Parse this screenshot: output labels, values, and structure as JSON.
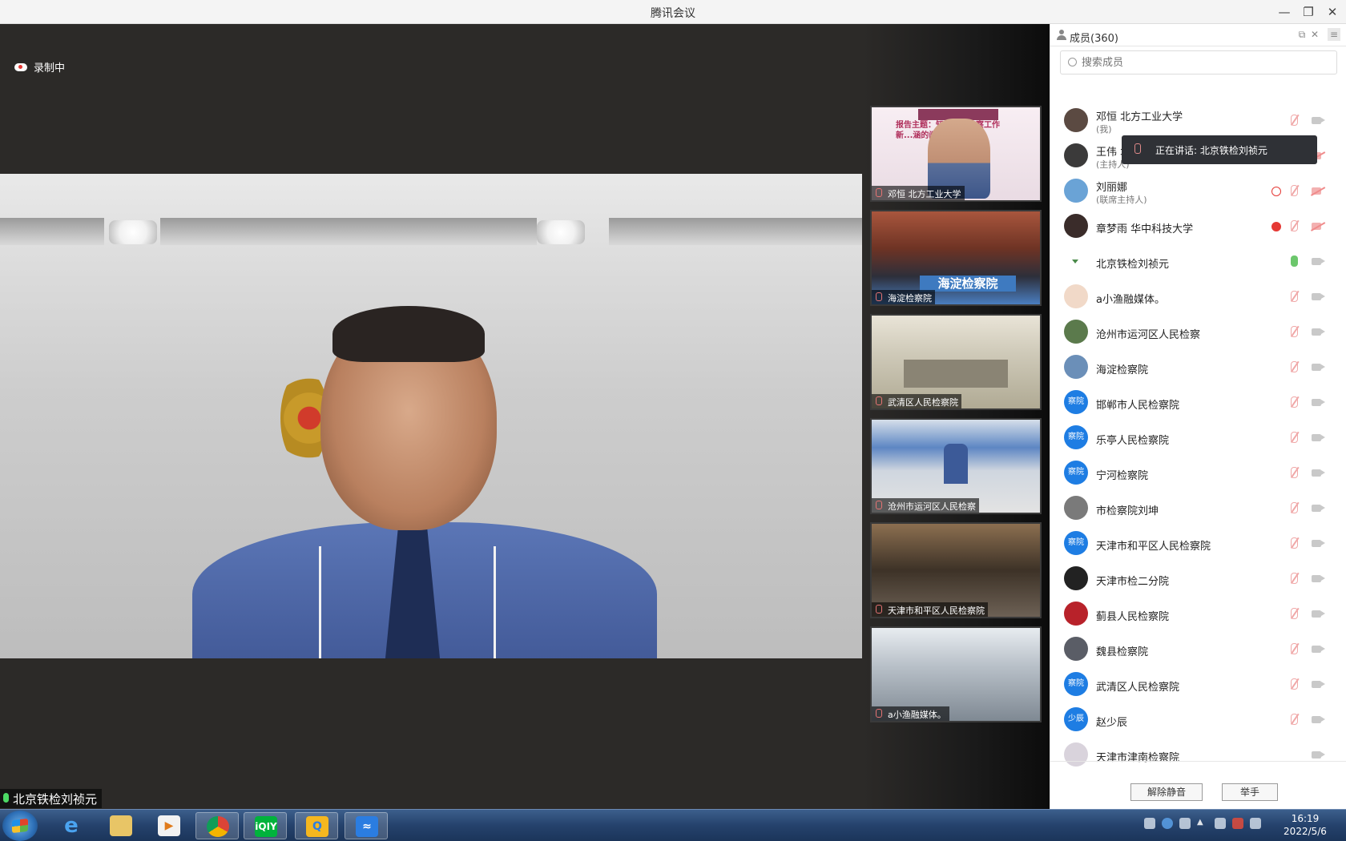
{
  "window": {
    "title": "腾讯会议"
  },
  "stage": {
    "recording_label": "录制中",
    "speaker_label": "北京铁检刘祯元"
  },
  "thumbnails": [
    {
      "label": "邓恒 北方工业大学",
      "overlay_text": "报告主题：知识产权检察工作新...涵的阐释"
    },
    {
      "label": "海淀检察院",
      "overlay_text": "海淀检察院"
    },
    {
      "label": "武清区人民检察院"
    },
    {
      "label": "沧州市运河区人民检察"
    },
    {
      "label": "天津市和平区人民检察院"
    },
    {
      "label": "a小渔融媒体。"
    }
  ],
  "members_panel": {
    "title": "成员(360)",
    "search_placeholder": "搜索成员",
    "speaking_tooltip": "正在讲话: 北京铁检刘祯元",
    "members": [
      {
        "name": "邓恒 北方工业大学",
        "sub": "(我)",
        "avatar_text": "",
        "avatar_color": "#5b4a42"
      },
      {
        "name": "王伟 北方工业大学",
        "sub": "(主持人)",
        "avatar_text": "",
        "avatar_color": "#3b3a3a"
      },
      {
        "name": "刘丽娜",
        "sub": "(联席主持人)",
        "avatar_text": "",
        "avatar_color": "#6aa3d6"
      },
      {
        "name": "章梦雨 华中科技大学",
        "sub": "",
        "avatar_text": "",
        "avatar_color": "#3a2c2a"
      },
      {
        "name": "北京铁检刘祯元",
        "sub": "",
        "avatar_text": "",
        "avatar_color": "#ffffff"
      },
      {
        "name": "a小渔融媒体。",
        "sub": "",
        "avatar_text": "",
        "avatar_color": "#f1d9c8"
      },
      {
        "name": "沧州市运河区人民检察",
        "sub": "",
        "avatar_text": "",
        "avatar_color": "#5b7a4c"
      },
      {
        "name": "海淀检察院",
        "sub": "",
        "avatar_text": "",
        "avatar_color": "#6b8fb8"
      },
      {
        "name": "邯郸市人民检察院",
        "sub": "",
        "avatar_text": "察院",
        "avatar_color": "#1e7de3"
      },
      {
        "name": "乐亭人民检察院",
        "sub": "",
        "avatar_text": "察院",
        "avatar_color": "#1e7de3"
      },
      {
        "name": "宁河检察院",
        "sub": "",
        "avatar_text": "察院",
        "avatar_color": "#1e7de3"
      },
      {
        "name": "市检察院刘坤",
        "sub": "",
        "avatar_text": "",
        "avatar_color": "#7a7a7a"
      },
      {
        "name": "天津市和平区人民检察院",
        "sub": "",
        "avatar_text": "察院",
        "avatar_color": "#1e7de3"
      },
      {
        "name": "天津市检二分院",
        "sub": "",
        "avatar_text": "",
        "avatar_color": "#222222"
      },
      {
        "name": "蓟县人民检察院",
        "sub": "",
        "avatar_text": "",
        "avatar_color": "#b8222a"
      },
      {
        "name": "魏县检察院",
        "sub": "",
        "avatar_text": "",
        "avatar_color": "#5a5d66"
      },
      {
        "name": "武清区人民检察院",
        "sub": "",
        "avatar_text": "察院",
        "avatar_color": "#1e7de3"
      },
      {
        "name": "赵少辰",
        "sub": "",
        "avatar_text": "少辰",
        "avatar_color": "#1e7de3"
      },
      {
        "name": "天津市津南检察院",
        "sub": "",
        "avatar_text": "",
        "avatar_color": "#d9d3dc"
      }
    ],
    "unmute_label": "解除静音",
    "raise_hand_label": "举手"
  },
  "taskbar": {
    "time": "16:19",
    "date": "2022/5/6",
    "apps": [
      "ie-icon",
      "explorer-icon",
      "media-player-icon",
      "chrome-icon",
      "iqiyi-icon",
      "qq-browser-icon",
      "tencent-meeting-icon"
    ]
  }
}
